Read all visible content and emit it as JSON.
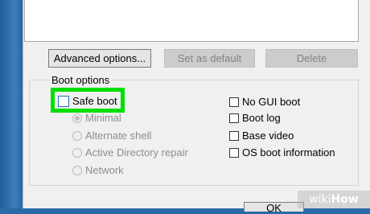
{
  "buttons": {
    "advanced": "Advanced options...",
    "set_default": "Set as default",
    "delete": "Delete"
  },
  "boot_options": {
    "label": "Boot options",
    "safe_boot": "Safe boot",
    "radios": [
      "Minimal",
      "Alternate shell",
      "Active Directory repair",
      "Network"
    ],
    "checks": [
      "No GUI boot",
      "Boot log",
      "Base video",
      "OS boot information"
    ]
  },
  "ok_label": "OK",
  "watermark": {
    "prefix": "wiki",
    "suffix": "How"
  },
  "colors": {
    "highlight": "#00e000",
    "dialog": "#f0f0f0",
    "desktop": "#2a6aa8"
  }
}
